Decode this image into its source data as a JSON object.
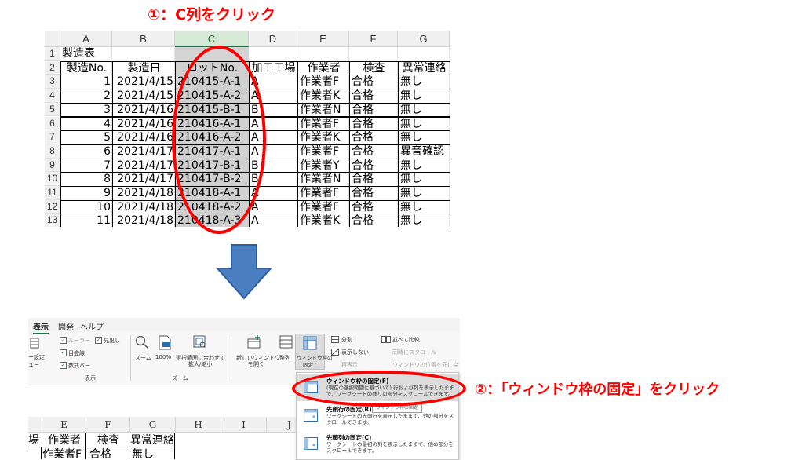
{
  "step1_label": "①：C列をクリック",
  "step2_label": "②：「ウィンドウ枠の固定」をクリック",
  "colors": {
    "accent": "#ff0000",
    "arrow": "#4a7fc1",
    "excel_green": "#217346"
  },
  "sheet": {
    "columns": [
      "A",
      "B",
      "C",
      "D",
      "E",
      "F",
      "G"
    ],
    "row_numbers": [
      "1",
      "2",
      "3",
      "4",
      "5",
      "6",
      "7",
      "8",
      "9",
      "10",
      "11",
      "12",
      "13"
    ],
    "title_cell": "製造表",
    "headers": [
      "製造No.",
      "製造日",
      "ロットNo.",
      "加工工場",
      "作業者",
      "検査",
      "異常連絡"
    ],
    "rows": [
      [
        "1",
        "2021/4/15",
        "210415-A-1",
        "A",
        "作業者F",
        "合格",
        "無し"
      ],
      [
        "2",
        "2021/4/15",
        "210415-A-2",
        "A",
        "作業者K",
        "合格",
        "無し"
      ],
      [
        "3",
        "2021/4/16",
        "210415-B-1",
        "B",
        "作業者N",
        "合格",
        "無し"
      ],
      [
        "4",
        "2021/4/16",
        "210416-A-1",
        "A",
        "作業者F",
        "合格",
        "無し"
      ],
      [
        "5",
        "2021/4/16",
        "210416-A-2",
        "A",
        "作業者K",
        "合格",
        "無し"
      ],
      [
        "6",
        "2021/4/17",
        "210417-A-1",
        "A",
        "作業者F",
        "合格",
        "異音確認"
      ],
      [
        "7",
        "2021/4/17",
        "210417-B-1",
        "B",
        "作業者Y",
        "合格",
        "無し"
      ],
      [
        "8",
        "2021/4/17",
        "210417-B-2",
        "B",
        "作業者N",
        "合格",
        "無し"
      ],
      [
        "9",
        "2021/4/18",
        "210418-A-1",
        "A",
        "作業者F",
        "合格",
        "無し"
      ],
      [
        "10",
        "2021/4/18",
        "210418-A-2",
        "A",
        "作業者F",
        "合格",
        "無し"
      ],
      [
        "11",
        "2021/4/18",
        "210418-A-3",
        "A",
        "作業者K",
        "合格",
        "無し"
      ]
    ]
  },
  "ribbon": {
    "tabs": [
      "表示",
      "開発",
      "ヘルプ"
    ],
    "show_group": {
      "left_labels": [
        "ー設定",
        "ュー"
      ],
      "ruler": "ルーラー",
      "headings": "見出し",
      "gridlines": "目盛線",
      "formula_bar": "数式バー",
      "group_name": "表示"
    },
    "zoom_group": {
      "zoom": "ズーム",
      "zoom100": "100%",
      "zoom_sel_line1": "選択範囲に合わせて",
      "zoom_sel_line2": "拡大/縮小",
      "group_name": "ズーム"
    },
    "window_group": {
      "new_window_line1": "新しいウィンドウ",
      "new_window_line2": "を開く",
      "arrange": "整列",
      "freeze_line1": "ウィンドウ枠の",
      "freeze_line2": "固定 ˅",
      "split": "分割",
      "hide": "表示しない",
      "unhide": "再表示",
      "side_by_side": "並べて比較",
      "sync_scroll": "同時にスクロール",
      "reset_pos": "ウィンドウの位置を元に戻す"
    }
  },
  "freeze_menu": [
    {
      "title": "ウィンドウ枠の固定(F)",
      "desc": "(現在の選択範囲に基づいて) 行および列を表示したままで、ワークシートの残りの部分をスクロールできます。"
    },
    {
      "title": "先頭行の固定(R)",
      "desc": "ワークシートの先頭行を表示したままで、他の部分をスクロールできます。"
    },
    {
      "title": "先頭列の固定(C)",
      "desc": "ワークシートの最初の列を表示したままで、他の部分をスクロールできます。"
    }
  ],
  "tooltip": "ウィンドウ枠の固定",
  "sheet2": {
    "columns": [
      "E",
      "F",
      "G",
      "H",
      "I",
      "J"
    ],
    "partial_left": "場",
    "headers": [
      "作業者",
      "検査",
      "異常連絡"
    ],
    "partial_row": [
      "作業者F",
      "合格",
      "無し"
    ]
  }
}
